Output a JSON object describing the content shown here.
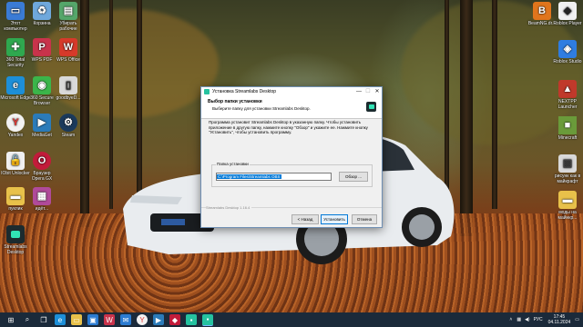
{
  "desktop": {
    "left_icons": [
      {
        "label": "Этот компьютер",
        "icon": "computer-icon",
        "color": "#3a7bd5"
      },
      {
        "label": "Корзина",
        "icon": "recycle-bin-icon",
        "color": "#6fa8dc"
      },
      {
        "label": "Убирать рабочие",
        "icon": "document-icon",
        "color": "#55a66a"
      },
      {
        "label": "360 Total Security",
        "icon": "360-security-icon",
        "color": "#2fa84f"
      },
      {
        "label": "WPS PDF",
        "icon": "wps-pdf-icon",
        "color": "#c8334b"
      },
      {
        "label": "WPS Office",
        "icon": "wps-office-icon",
        "color": "#d63a2a"
      },
      {
        "label": "Microsoft Edge",
        "icon": "edge-icon",
        "color": "#1d8fd8"
      },
      {
        "label": "360 Secure Browser",
        "icon": "360-browser-icon",
        "color": "#3bb54a"
      },
      {
        "label": "goodbyeD...",
        "icon": "file-icon",
        "color": "#d9d9d9"
      },
      {
        "label": "Yandex",
        "icon": "yandex-icon",
        "color": "#f2f2f2"
      },
      {
        "label": "MediaGet",
        "icon": "mediaget-icon",
        "color": "#2b7bb9"
      },
      {
        "label": "Steam",
        "icon": "steam-icon",
        "color": "#1b3a5c"
      },
      {
        "label": "IObit Unlocker",
        "icon": "iobit-unlocker-icon",
        "color": "#f0f0f0"
      },
      {
        "label": "Браузер Opera GX",
        "icon": "opera-gx-icon",
        "color": "#c21b3a"
      },
      {
        "label": "пуклик",
        "icon": "folder-icon",
        "color": "#e8c14a"
      },
      {
        "label": "идёт...",
        "icon": "archive-icon",
        "color": "#b04a9a"
      },
      {
        "label": "Streamlabs Desktop",
        "icon": "streamlabs-icon",
        "color": "#1c2b2f"
      }
    ],
    "right_icons": [
      {
        "label": "BeamNG.dr...",
        "icon": "beamng-icon",
        "color": "#e0751c"
      },
      {
        "label": "Roblox Player",
        "icon": "roblox-icon",
        "color": "#f0f0f0"
      },
      {
        "label": "Roblox Studio",
        "icon": "roblox-studio-icon",
        "color": "#2f7de1"
      },
      {
        "label": "NEXTPP Launcher",
        "icon": "launcher-icon",
        "color": "#c0392b"
      },
      {
        "label": "Minecraft",
        "icon": "minecraft-icon",
        "color": "#6a9b3a"
      },
      {
        "label": "рисунк как в майкрафт",
        "icon": "image-icon",
        "color": "#d9d9d9"
      },
      {
        "label": "моды на майнкр...",
        "icon": "folder-icon",
        "color": "#e8c14a"
      }
    ]
  },
  "installer": {
    "window_title": "Установка Streamlabs Desktop",
    "minimize": "—",
    "maximize": "☐",
    "close": "✕",
    "header_title": "Выбор папки установки",
    "header_subtitle": "Выберите папку для установки Streamlabs Desktop.",
    "body": "Программа установит Streamlabs Desktop в указанную папку. Чтобы установить приложение в другую папку, нажмите кнопку \"Обзор\" и укажите ее. Нажмите кнопку \"Установить\", чтобы установить программу.",
    "group_label": "Папка установки",
    "path_value": "C:\\Program Files\\Streamlabs OBS",
    "browse_label": "Обзор ...",
    "version": "Streamlabs Desktop 1.16.4",
    "back_label": "< Назад",
    "install_label": "Установить",
    "cancel_label": "Отмена"
  },
  "taskbar": {
    "items": [
      {
        "icon": "start-icon",
        "glyph": "⊞",
        "color": "#1b2a3a"
      },
      {
        "icon": "search-icon",
        "glyph": "⌕",
        "color": "#1b2a3a"
      },
      {
        "icon": "task-view-icon",
        "glyph": "❐",
        "color": "#1b2a3a"
      },
      {
        "icon": "edge-icon",
        "glyph": "e",
        "color": "#1d8fd8"
      },
      {
        "icon": "explorer-icon",
        "glyph": "▭",
        "color": "#e8c14a"
      },
      {
        "icon": "store-icon",
        "glyph": "▣",
        "color": "#2b7bd1"
      },
      {
        "icon": "wps-icon",
        "glyph": "W",
        "color": "#c8334b"
      },
      {
        "icon": "mail-icon",
        "glyph": "✉",
        "color": "#2b7bd1"
      },
      {
        "icon": "yandex-icon",
        "glyph": "Y",
        "color": "#f2f2f2"
      },
      {
        "icon": "media-icon",
        "glyph": "▶",
        "color": "#2b7bb9"
      },
      {
        "icon": "app-icon",
        "glyph": "◆",
        "color": "#c21b3a"
      },
      {
        "icon": "streamlabs-icon",
        "glyph": "▪",
        "color": "#25c2a0"
      },
      {
        "icon": "installer-icon",
        "glyph": "▪",
        "color": "#25c2a0"
      }
    ],
    "language": "РУС",
    "time": "17:45",
    "date": "04.11.2024"
  }
}
